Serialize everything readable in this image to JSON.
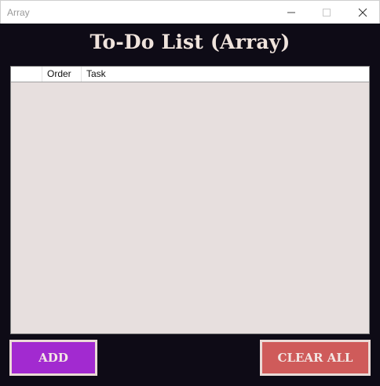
{
  "window": {
    "title": "Array",
    "controls": [
      "minimize-icon",
      "maximize-icon",
      "close-icon"
    ]
  },
  "header": {
    "title": "To-Do List (Array)"
  },
  "list": {
    "columns": [
      "",
      "Order",
      "Task"
    ],
    "rows": []
  },
  "buttons": {
    "add_label": "ADD",
    "clear_label": "CLEAR ALL"
  },
  "colors": {
    "background": "#0e0b16",
    "add_button": "#a22ad0",
    "clear_button": "#cf5b5a",
    "list_background": "#e7dfde",
    "heading_text": "#efe3dc"
  }
}
